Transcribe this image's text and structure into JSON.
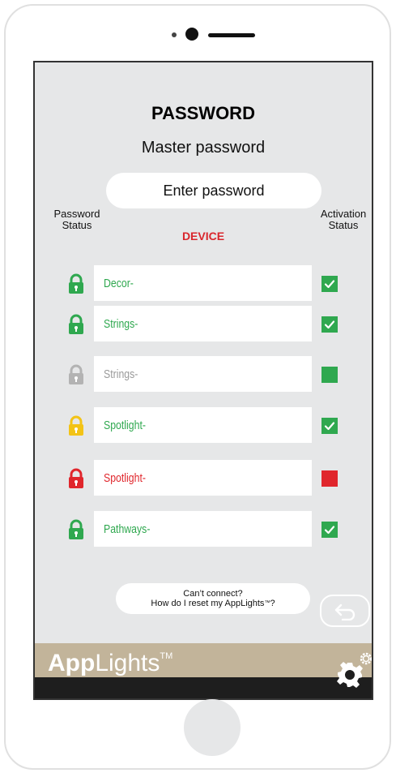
{
  "screen": {
    "title": "PASSWORD",
    "subtitle": "Master password",
    "password_placeholder": "Enter password",
    "col_left": "Password Status",
    "col_right": "Activation Status",
    "device_header": "DEVICE"
  },
  "devices": [
    {
      "name": "Decor-",
      "lock_color": "#2fa84f",
      "text_color": "#2fa84f",
      "activation": "checked",
      "box_color": "#2fa84f"
    },
    {
      "name": "Strings-",
      "lock_color": "#2fa84f",
      "text_color": "#2fa84f",
      "activation": "checked",
      "box_color": "#2fa84f"
    },
    {
      "name": "Strings-",
      "lock_color": "#b3b3b3",
      "text_color": "#9a9a9a",
      "activation": "unchecked",
      "box_color": "#2fa84f"
    },
    {
      "name": "Spotlight-",
      "lock_color": "#f3c316",
      "text_color": "#2fa84f",
      "activation": "checked",
      "box_color": "#2fa84f"
    },
    {
      "name": "Spotlight-",
      "lock_color": "#e0262c",
      "text_color": "#e0262c",
      "activation": "unchecked",
      "box_color": "#e0262c"
    },
    {
      "name": "Pathways-",
      "lock_color": "#2fa84f",
      "text_color": "#2fa84f",
      "activation": "checked",
      "box_color": "#2fa84f"
    }
  ],
  "help": {
    "line1": "Can’t connect?",
    "line2": "How do I reset my AppLights",
    "line2_mark": "™",
    "line2_end": "?"
  },
  "brand": {
    "bold": "App",
    "light": "Lights",
    "mark": "TM"
  },
  "icons": {
    "back": "back-arrow-icon",
    "settings": "gear-icon",
    "lock": "lock-icon",
    "check": "checkmark-icon"
  },
  "colors": {
    "accent_green": "#2fa84f",
    "accent_red": "#e0262c",
    "accent_yellow": "#f3c316",
    "bar_tan": "#c2b49a"
  }
}
